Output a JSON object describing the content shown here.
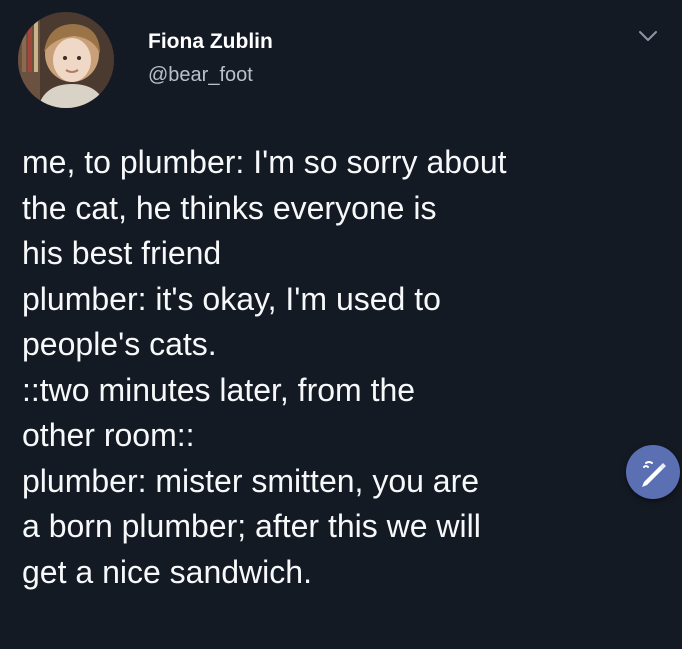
{
  "tweet": {
    "author": {
      "display_name": "Fiona Zublin",
      "handle": "@bear_foot",
      "avatar_icon": "user-avatar-photo"
    },
    "menu_icon": "chevron-down-icon",
    "text_lines": [
      "me, to plumber: I'm so sorry about",
      "the cat, he thinks everyone is",
      "his best friend",
      "plumber: it's okay, I'm used to",
      "people's cats.",
      "::two minutes later, from the",
      "other room::",
      "plumber: mister smitten, you are",
      "a born plumber; after this we will",
      "get a nice sandwich."
    ]
  },
  "compose_button": {
    "icon": "feather-pen-icon",
    "color": "#5b6fb3"
  },
  "colors": {
    "background": "#141a24",
    "text": "#f7f8fa",
    "handle": "#b9c0c8",
    "accent": "#5b6fb3"
  }
}
